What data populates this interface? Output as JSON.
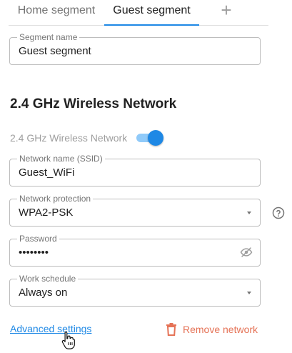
{
  "tabs": {
    "items": [
      {
        "label": "Home segment",
        "active": false
      },
      {
        "label": "Guest segment",
        "active": true
      }
    ],
    "add_label": "+"
  },
  "segment": {
    "label": "Segment name",
    "value": "Guest segment"
  },
  "wireless": {
    "title": "2.4 GHz Wireless Network",
    "toggle_label": "2.4 GHz Wireless Network",
    "enabled": true,
    "ssid_label": "Network name (SSID)",
    "ssid_value": "Guest_WiFi",
    "protection_label": "Network protection",
    "protection_value": "WPA2-PSK",
    "password_label": "Password",
    "password_value": "••••••••",
    "schedule_label": "Work schedule",
    "schedule_value": "Always on"
  },
  "actions": {
    "advanced_label": "Advanced settings",
    "remove_label": "Remove network"
  },
  "colors": {
    "accent": "#1e88e5",
    "toggle_track": "#90caf9",
    "danger": "#e57357"
  },
  "icons": {
    "password_visibility": "eye-off-icon",
    "help": "help-circle-icon",
    "remove": "trash-icon",
    "cursor": "hand-pointer-icon"
  }
}
